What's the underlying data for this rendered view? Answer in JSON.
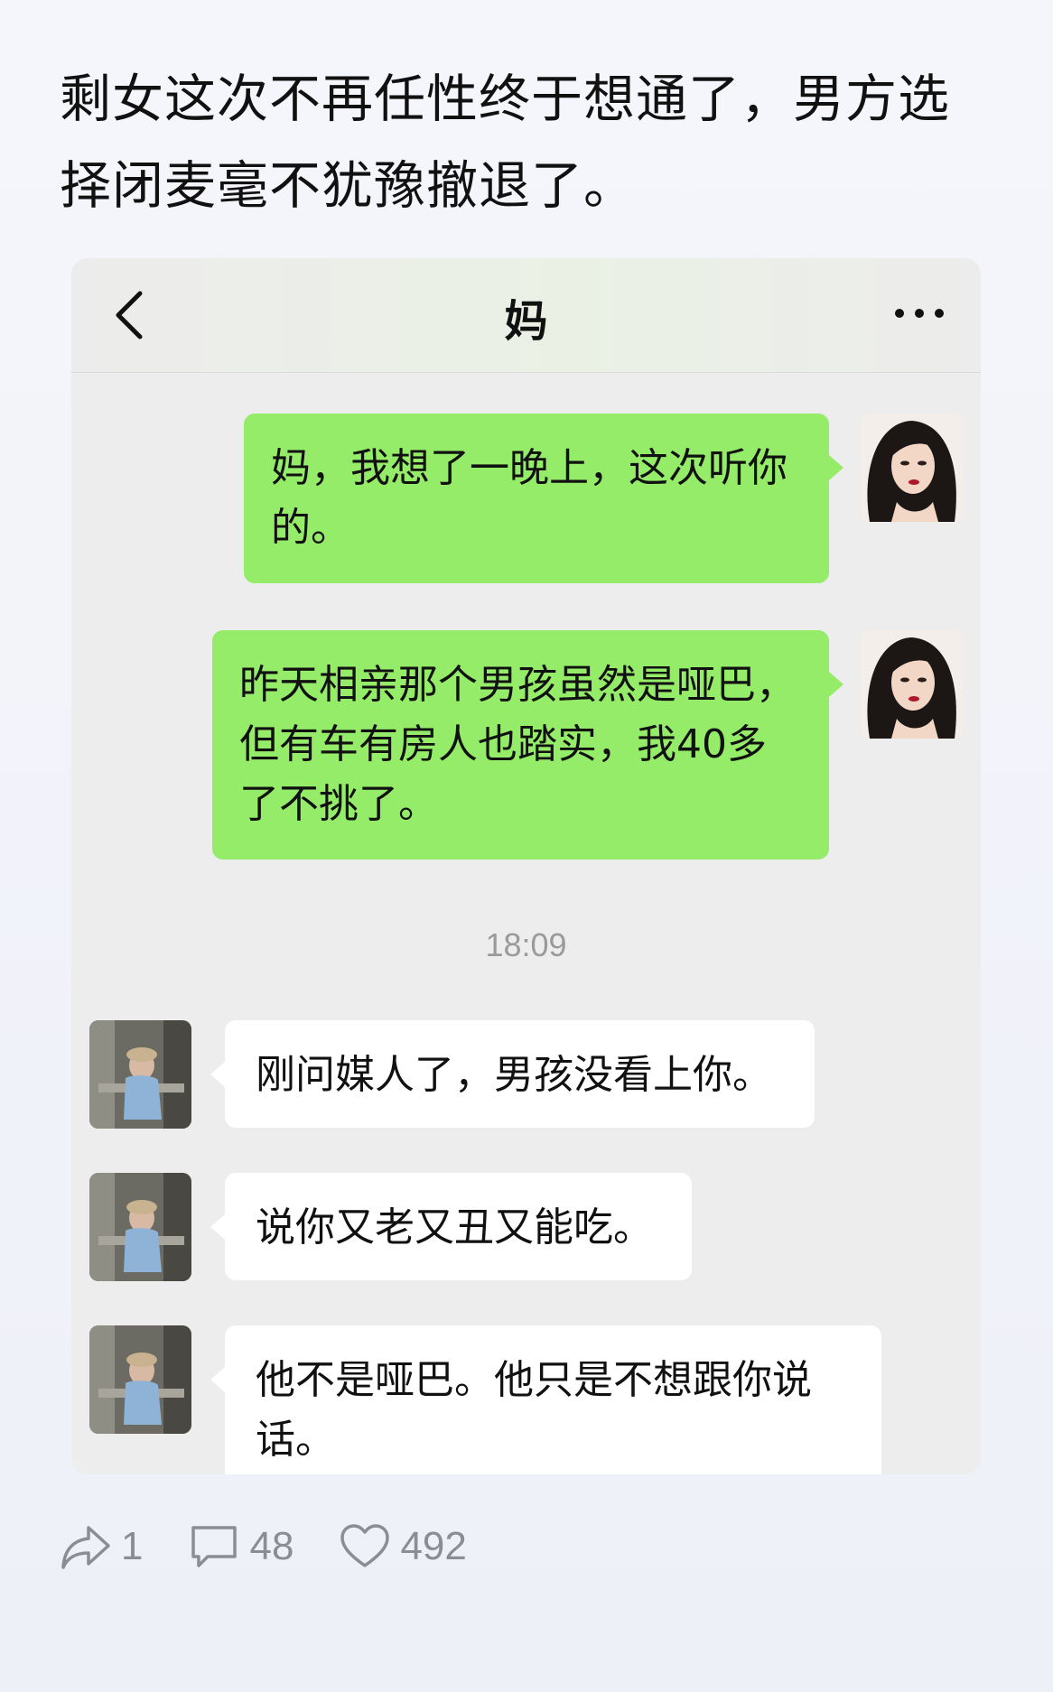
{
  "post": {
    "title": "剩女这次不再任性终于想通了，男方选择闭麦毫不犹豫撤退了。"
  },
  "chat": {
    "header": {
      "title": "妈",
      "back_icon": "chevron-left-icon",
      "more_icon": "more-dots-icon"
    },
    "messages": [
      {
        "side": "right",
        "text": "妈，我想了一晚上，这次听你的。"
      },
      {
        "side": "right",
        "text": "昨天相亲那个男孩虽然是哑巴，但有车有房人也踏实，我40多了不挑了。"
      },
      {
        "side": "left",
        "text": "刚问媒人了，男孩没看上你。"
      },
      {
        "side": "left",
        "text": "说你又老又丑又能吃。"
      },
      {
        "side": "left",
        "text": "他不是哑巴。他只是不想跟你说话。"
      }
    ],
    "timestamp": "18:09",
    "colors": {
      "sent_bubble": "#95ec69",
      "received_bubble": "#ffffff",
      "background": "#ededed"
    }
  },
  "actions": {
    "share": {
      "icon": "share-icon",
      "count": "1"
    },
    "comment": {
      "icon": "comment-icon",
      "count": "48"
    },
    "like": {
      "icon": "heart-icon",
      "count": "492"
    }
  }
}
